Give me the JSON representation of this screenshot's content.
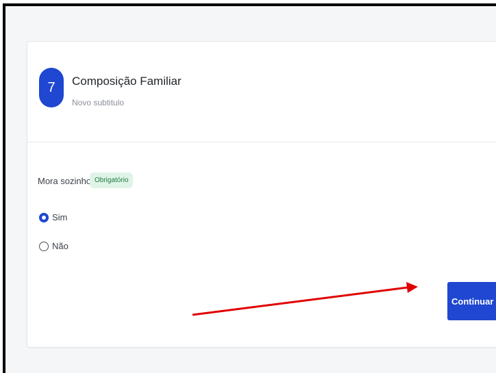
{
  "step": {
    "number": "7",
    "title": "Composição Familiar",
    "subtitle": "Novo subtitulo"
  },
  "question": {
    "label": "Mora sozinho?",
    "badge": "Obrigatório",
    "options": [
      {
        "label": "Sim",
        "selected": true
      },
      {
        "label": "Não",
        "selected": false
      }
    ]
  },
  "actions": {
    "continue_label": "Continuar"
  },
  "colors": {
    "primary": "#1f47d1",
    "badge_bg": "#dff4e7",
    "badge_text": "#1f7a45",
    "annotation_arrow": "#e00000"
  }
}
